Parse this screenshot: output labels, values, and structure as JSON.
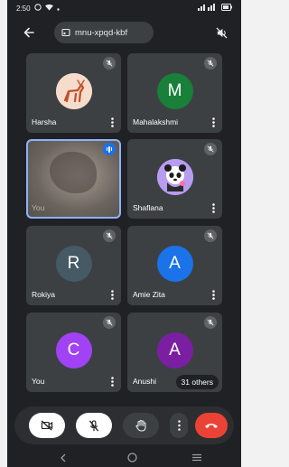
{
  "status_bar": {
    "time": "2:50",
    "left_icons": [
      "media-icon",
      "wifi-icon",
      "dot-icon"
    ],
    "right_icons": [
      "signal-icon",
      "battery-icon"
    ]
  },
  "top_bar": {
    "meeting_code": "mnu-xpqd-kbf"
  },
  "participants": [
    {
      "name": "Harsha",
      "avatar_type": "image",
      "muted": true
    },
    {
      "name": "Mahalakshmi",
      "avatar_type": "letter",
      "letter": "M",
      "color": "#188038",
      "muted": true
    },
    {
      "name": "You",
      "avatar_type": "video",
      "speaking": true
    },
    {
      "name": "Shaflana",
      "avatar_type": "image",
      "muted": true
    },
    {
      "name": "Rokiya",
      "avatar_type": "letter",
      "letter": "R",
      "color": "#455a64",
      "muted": true
    },
    {
      "name": "Amie Zita",
      "avatar_type": "letter",
      "letter": "A",
      "color": "#1a73e8",
      "muted": true
    },
    {
      "name": "You",
      "avatar_type": "letter",
      "letter": "C",
      "color": "#a142f4",
      "muted": true
    },
    {
      "name": "Anushi",
      "avatar_type": "letter",
      "letter": "A",
      "color": "#7b1fa2",
      "muted": true,
      "others_label": "31 others"
    }
  ],
  "controls": {
    "buttons": [
      "camera-off",
      "mic-off",
      "raise-hand",
      "more-options",
      "end-call"
    ],
    "end_call_color": "#ea4335"
  },
  "colors": {
    "background": "#202124",
    "tile": "#3c4043",
    "accent": "#8ab4f8"
  }
}
